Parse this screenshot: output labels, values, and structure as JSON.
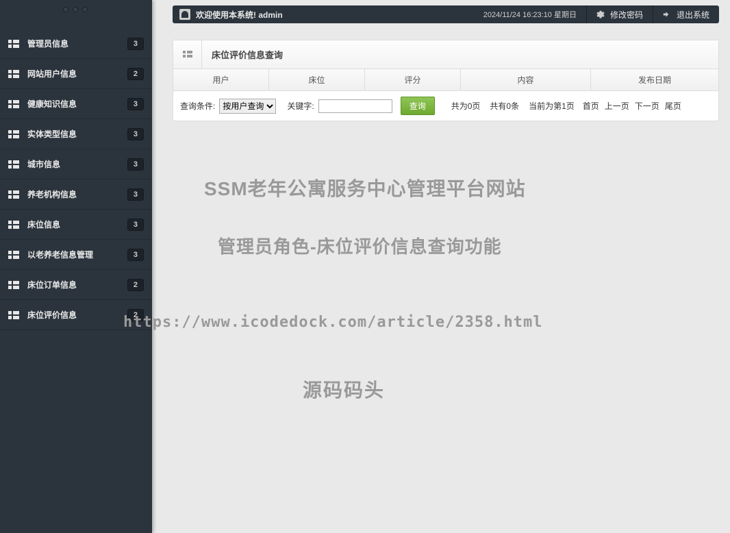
{
  "topbar": {
    "welcome": "欢迎使用本系统! admin",
    "datetime": "2024/11/24 16:23:10 星期日",
    "change_password": "修改密码",
    "logout": "退出系统"
  },
  "sidebar": {
    "items": [
      {
        "label": "管理员信息",
        "badge": "3"
      },
      {
        "label": "网站用户信息",
        "badge": "2"
      },
      {
        "label": "健康知识信息",
        "badge": "3"
      },
      {
        "label": "实体类型信息",
        "badge": "3"
      },
      {
        "label": "城市信息",
        "badge": "3"
      },
      {
        "label": "养老机构信息",
        "badge": "3"
      },
      {
        "label": "床位信息",
        "badge": "3"
      },
      {
        "label": "以老养老信息管理",
        "badge": "3"
      },
      {
        "label": "床位订单信息",
        "badge": "2"
      },
      {
        "label": "床位评价信息",
        "badge": "2"
      }
    ]
  },
  "panel": {
    "title": "床位评价信息查询",
    "columns": {
      "c0": "用户",
      "c1": "床位",
      "c2": "评分",
      "c3": "内容",
      "c4": "发布日期"
    },
    "search": {
      "condition_label": "查询条件:",
      "condition_option": "按用户查询",
      "keyword_label": "关键字:",
      "button": "查询",
      "page_total": "共为0页",
      "record_total": "共有0条",
      "current_page": "当前为第1页",
      "first": "首页",
      "prev": "上一页",
      "next": "下一页",
      "last": "尾页"
    }
  },
  "watermark": {
    "line1": "SSM老年公寓服务中心管理平台网站",
    "line2": "管理员角色-床位评价信息查询功能",
    "line3": "https://www.icodedock.com/article/2358.html",
    "line4": "源码码头"
  }
}
